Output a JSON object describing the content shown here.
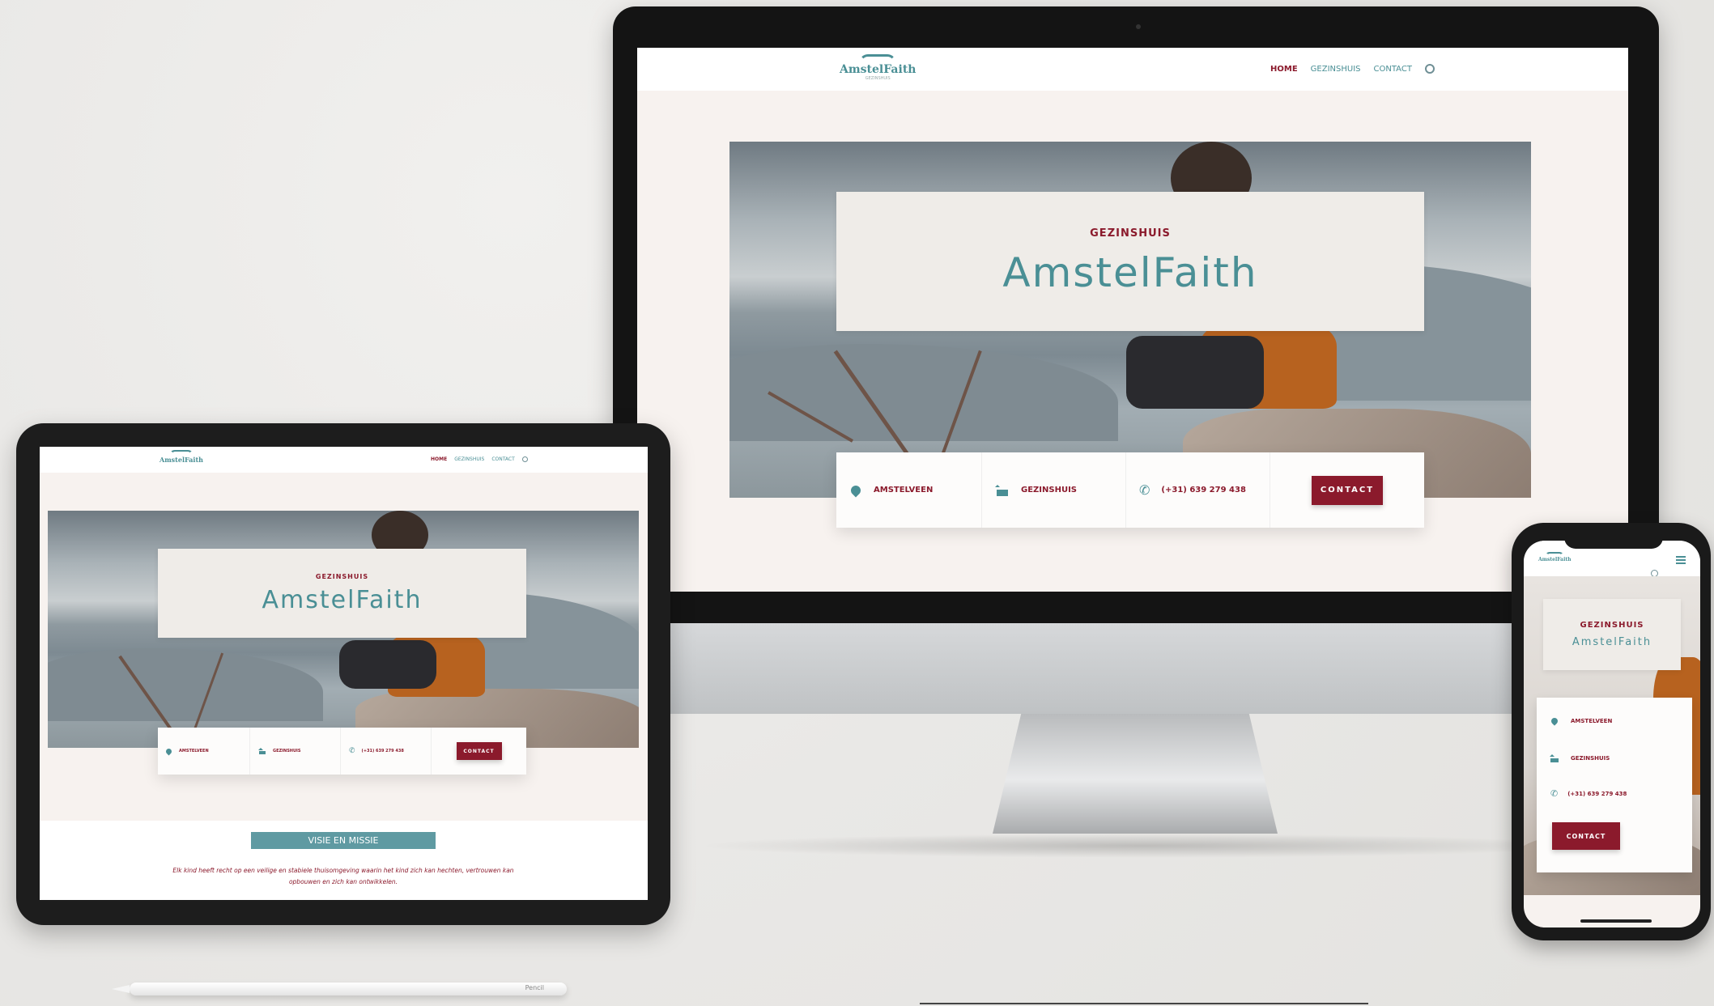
{
  "brand": {
    "logo_text": "AmstelFaith",
    "hero_eyebrow": "GEZINSHUIS",
    "hero_title": "AmstelFaith"
  },
  "nav": {
    "home": "HOME",
    "gezinshuis": "GEZINSHUIS",
    "contact": "CONTACT"
  },
  "info": {
    "location": "AMSTELVEEN",
    "type": "GEZINSHUIS",
    "phone": "(+31) 639 279 438",
    "button": "CONTACT"
  },
  "tablet_extra": {
    "section_button": "VISIE EN MISSIE",
    "mission_line1": "Elk kind heeft recht op een veilige en stabiele thuisomgeving waarin het kind zich kan hechten, vertrouwen kan",
    "mission_line2": "opbouwen en zich kan ontwikkelen."
  },
  "pencil_label": "Pencil",
  "colors": {
    "accent_teal": "#4a8f95",
    "brand_red": "#8b1a2c",
    "page_bg": "#f7f2ef"
  },
  "icons": [
    "pin-icon",
    "house-icon",
    "phone-icon",
    "search-icon",
    "hamburger-icon"
  ]
}
